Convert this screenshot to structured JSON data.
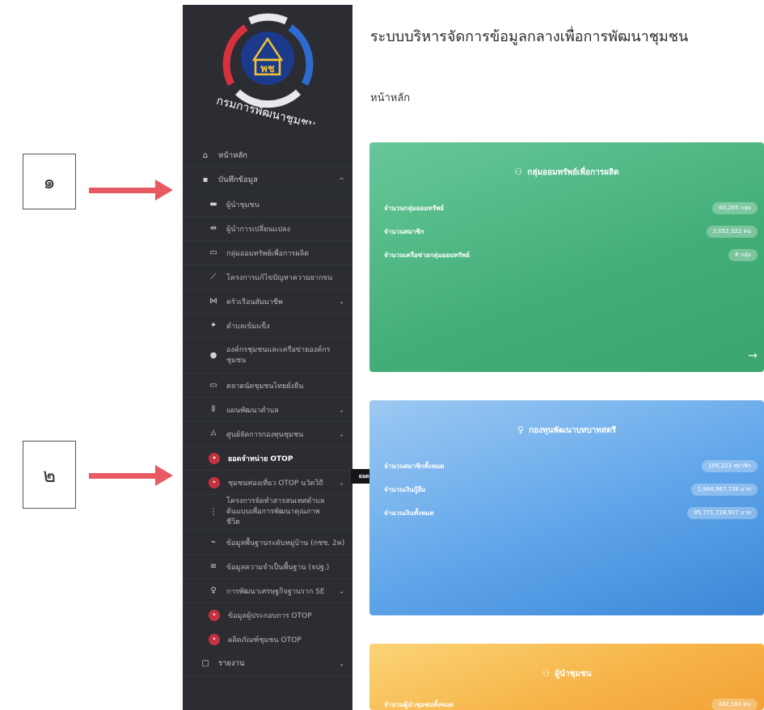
{
  "callouts": [
    {
      "label": "๑"
    },
    {
      "label": "๒"
    }
  ],
  "logo": {
    "caption": "กรมการพัฒนาชุมชน",
    "emblem_text": "พช"
  },
  "header": {
    "title": "ระบบบริหารจัดการข้อมูลกลางเพื่อการพัฒนาชุมชน"
  },
  "breadcrumb": "หน้าหลัก",
  "sidebar": {
    "items": [
      {
        "label": "หน้าหลัก",
        "icon": "home-icon",
        "glyph": "⌂"
      },
      {
        "label": "บันทึกข้อมูล",
        "icon": "save-icon",
        "glyph": "▪",
        "chevron": "^"
      },
      {
        "label": "ผู้นำชุมชน",
        "icon": "people-icon",
        "glyph": "▬"
      },
      {
        "label": "ผู้นำการเปลี่ยนแปลง",
        "icon": "people-icon",
        "glyph": "⇹"
      },
      {
        "label": "กลุ่มออมทรัพย์เพื่อการผลิต",
        "icon": "bank-icon",
        "glyph": "▭"
      },
      {
        "label": "โครงการแก้ไขปัญหาความยากจน",
        "icon": "tool-icon",
        "glyph": "⟋"
      },
      {
        "label": "ครัวเรือนสัมมาชีพ",
        "icon": "group-icon",
        "glyph": "⋈",
        "chevron": "⌄"
      },
      {
        "label": "ตำบลเข้มแข็ง",
        "icon": "tree-icon",
        "glyph": "✦"
      },
      {
        "label": "องค์กรชุมชนและเครือข่ายองค์กรชุมชน",
        "icon": "network-icon",
        "glyph": "●"
      },
      {
        "label": "ตลาดนัดชุมชนไทยยั่งยืน",
        "icon": "shop-icon",
        "glyph": "▭"
      },
      {
        "label": "แผนพัฒนาตำบล",
        "icon": "chart-icon",
        "glyph": "⦀",
        "chevron": "⌄"
      },
      {
        "label": "ศูนย์จัดการกองทุนชุมชน",
        "icon": "fund-icon",
        "glyph": "⛼",
        "chevron": "⌄"
      },
      {
        "label": "ยอดจำหน่าย OTOP",
        "icon": "otop-icon",
        "glyph": "•"
      },
      {
        "label": "ชุมชนท่องเที่ยว OTOP นวัตวิถี",
        "icon": "otop-icon",
        "glyph": "•",
        "chevron": "⌄"
      },
      {
        "label": "โครงการจัดทำสารสนเทศตำบลต้นแบบเพื่อการพัฒนาคุณภาพชีวิต",
        "icon": "info-icon",
        "glyph": "⋮"
      },
      {
        "label": "ข้อมูลพื้นฐานระดับหมู่บ้าน (กชช. 2ค)",
        "icon": "village-icon",
        "glyph": "⌁"
      },
      {
        "label": "ข้อมูลความจำเป็นพื้นฐาน (จปฐ.)",
        "icon": "database-icon",
        "glyph": "≡"
      },
      {
        "label": "การพัฒนาเศรษฐกิจฐานราก SE",
        "icon": "bulb-icon",
        "glyph": "♀",
        "chevron": "⌄"
      },
      {
        "label": "ข้อมูลผู้ประกอบการ OTOP",
        "icon": "otop-icon",
        "glyph": "•"
      },
      {
        "label": "ผลิตภัณฑ์ชุมชน OTOP",
        "icon": "otop-icon",
        "glyph": "•"
      },
      {
        "label": "รายงาน",
        "icon": "report-icon",
        "glyph": "▢",
        "chevron": "⌄"
      }
    ],
    "tooltip": "ยอดจำหน่าย OTOP"
  },
  "cards": {
    "savings": {
      "title": "กลุ่มออมทรัพย์เพื่อการผลิต",
      "stats": [
        {
          "label": "จำนวนกลุ่มออมทรัพย์",
          "value": "60,265 กลุ่ม"
        },
        {
          "label": "จำนวนสมาชิก",
          "value": "2,052,322 คน"
        },
        {
          "label": "จำนวนเครือข่ายกลุ่มออมทรัพย์",
          "value": "8 กลุ่ม"
        }
      ],
      "arrow": "→"
    },
    "fund": {
      "title": "กองทุนพัฒนาบทบาทสตรี",
      "stats": [
        {
          "label": "จำนวนสมาชิกทั้งหมด",
          "value": "105,223 สมาชิก"
        },
        {
          "label": "จำนวนเงินกู้ยืม",
          "value": "2,964,967,738 บาท"
        },
        {
          "label": "จำนวนเงินทั้งหมด",
          "value": "95,771,728,907 บาท"
        }
      ]
    },
    "leaders": {
      "title": "ผู้นำชุมชน",
      "stats": [
        {
          "label": "จำนวนผู้นำชุมชนทั้งหมด",
          "value": "482,583 คน"
        }
      ]
    }
  },
  "colors": {
    "sidebar_bg": "#2b2d33",
    "green_card": "#42ad77",
    "blue_card": "#5fa5ea",
    "orange_card": "#f6b347",
    "arrow": "#e85a63",
    "otop_icon": "#c4323f"
  }
}
